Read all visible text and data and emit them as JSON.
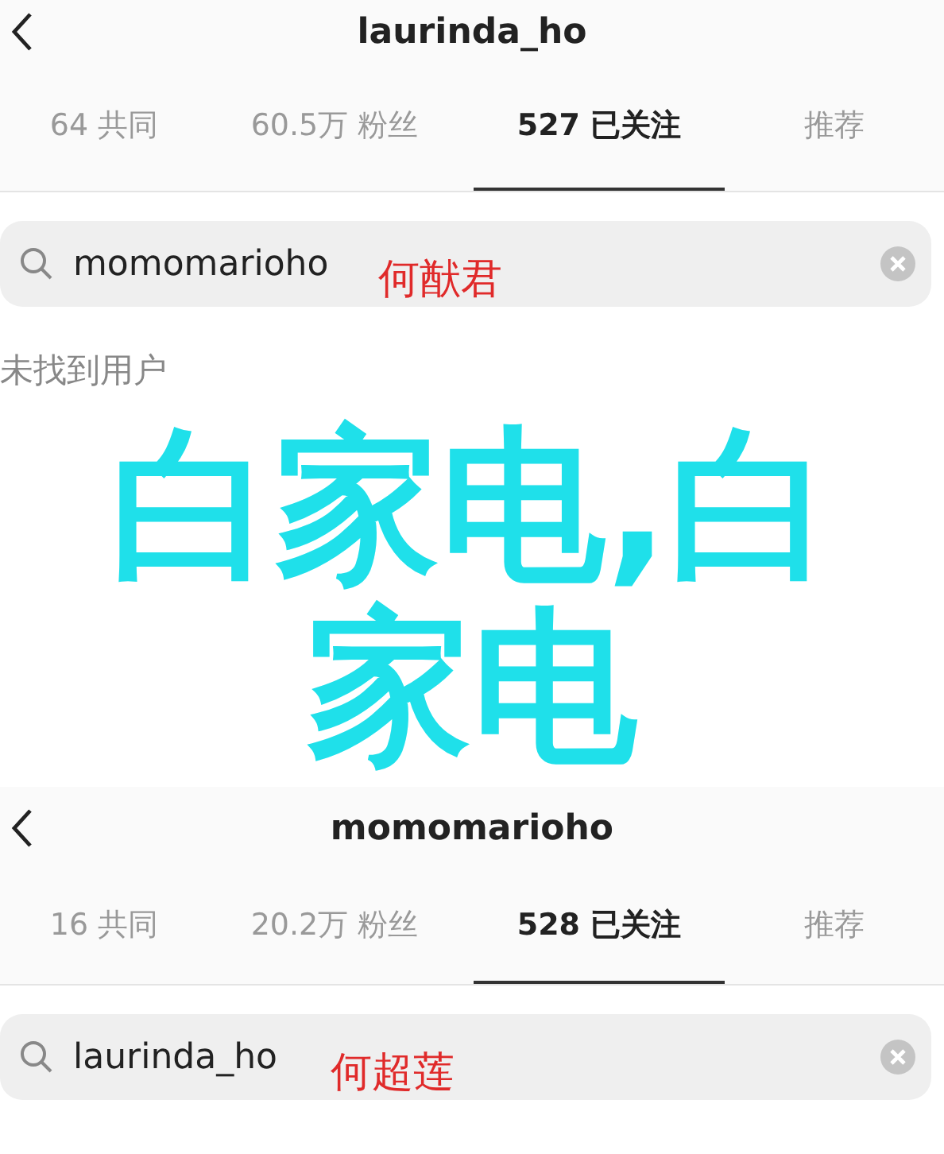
{
  "panels": [
    {
      "title": "laurinda_ho",
      "tabs": [
        {
          "label": "64 共同",
          "selected": false
        },
        {
          "label": "60.5万 粉丝",
          "selected": false
        },
        {
          "label": "527 已关注",
          "selected": true
        },
        {
          "label": "推荐",
          "selected": false
        }
      ],
      "search": {
        "value": "momomarioho",
        "annotation": "何猷君"
      },
      "message": "未找到用户"
    },
    {
      "title": "momomarioho",
      "tabs": [
        {
          "label": "16 共同",
          "selected": false
        },
        {
          "label": "20.2万 粉丝",
          "selected": false
        },
        {
          "label": "528 已关注",
          "selected": true
        },
        {
          "label": "推荐",
          "selected": false
        }
      ],
      "search": {
        "value": "laurinda_ho",
        "annotation": "何超莲"
      }
    }
  ],
  "overlay_caption": "白家电,白家电"
}
